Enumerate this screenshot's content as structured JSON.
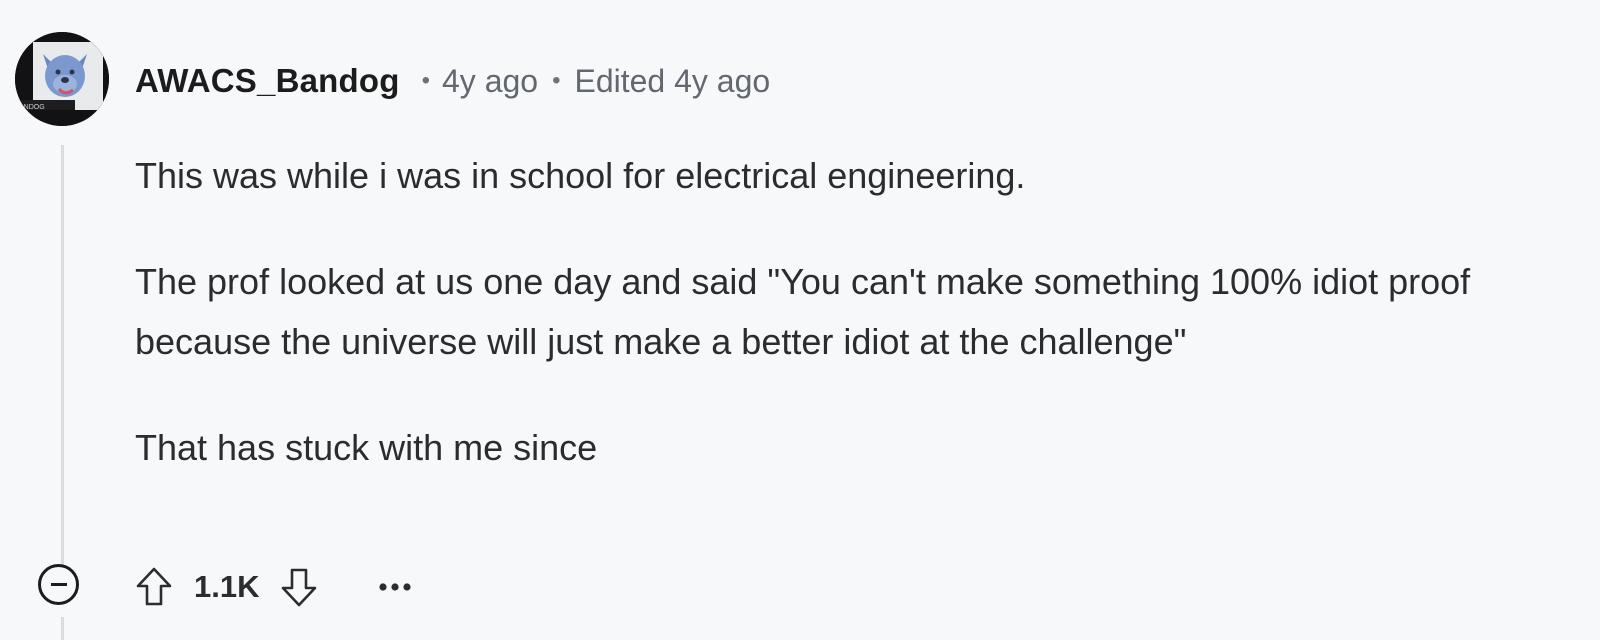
{
  "comment": {
    "author": "AWACS_Bandog",
    "separator": "•",
    "age": "4y ago",
    "edited": "Edited 4y ago",
    "avatar": {
      "icon": "bulldog-avatar-icon",
      "caption": "ANDOG"
    },
    "paragraphs": [
      "This was while i was in school for electrical engineering.",
      "The prof looked at us one day and said \"You can't make something 100% idiot proof because the universe will just make a better idiot at the challenge\"",
      "That has stuck with me since"
    ],
    "actions": {
      "collapse_icon": "collapse-minus-icon",
      "upvote_icon": "upvote-arrow-icon",
      "score": "1.1K",
      "downvote_icon": "downvote-arrow-icon",
      "more_icon": "more-dots-icon"
    }
  },
  "colors": {
    "background": "#f7f8fa",
    "thread_line": "#d9dce0",
    "text": "#1c1c1c",
    "meta_text": "#626770",
    "avatar_blue": "#7b98cf"
  }
}
